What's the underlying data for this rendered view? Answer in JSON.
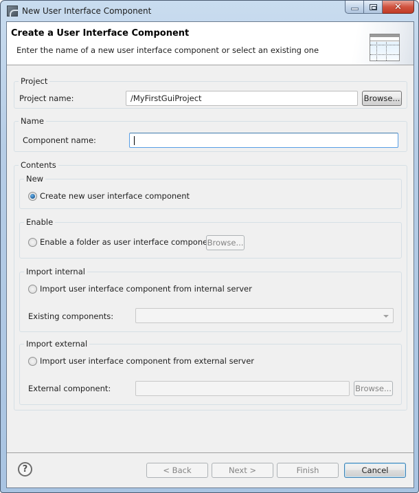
{
  "window": {
    "title": "New User Interface Component",
    "controls": {
      "minimize": "minimize",
      "maximize": "maximize",
      "close": "close"
    }
  },
  "header": {
    "title": "Create a User Interface Component",
    "description": "Enter the name of a new user interface component or select an existing one",
    "icon": "wizard-table-icon"
  },
  "project": {
    "group_label": "Project",
    "name_label": "Project name:",
    "name_value": "/MyFirstGuiProject",
    "browse_label": "Browse..."
  },
  "name": {
    "group_label": "Name",
    "component_label": "Component name:",
    "component_value": ""
  },
  "contents": {
    "group_label": "Contents",
    "new": {
      "group_label": "New",
      "radio_label": "Create new user interface component",
      "checked": true
    },
    "enable": {
      "group_label": "Enable",
      "radio_label": "Enable a folder as user interface component",
      "checked": false,
      "browse_label": "Browse..."
    },
    "import_internal": {
      "group_label": "Import internal",
      "radio_label": "Import user interface component from internal server",
      "checked": false,
      "existing_label": "Existing components:",
      "existing_value": ""
    },
    "import_external": {
      "group_label": "Import external",
      "radio_label": "Import user interface component from external server",
      "checked": false,
      "external_label": "External component:",
      "external_value": "",
      "browse_label": "Browse..."
    }
  },
  "footer": {
    "help_icon": "?",
    "back_label": "< Back",
    "next_label": "Next >",
    "finish_label": "Finish",
    "cancel_label": "Cancel"
  }
}
